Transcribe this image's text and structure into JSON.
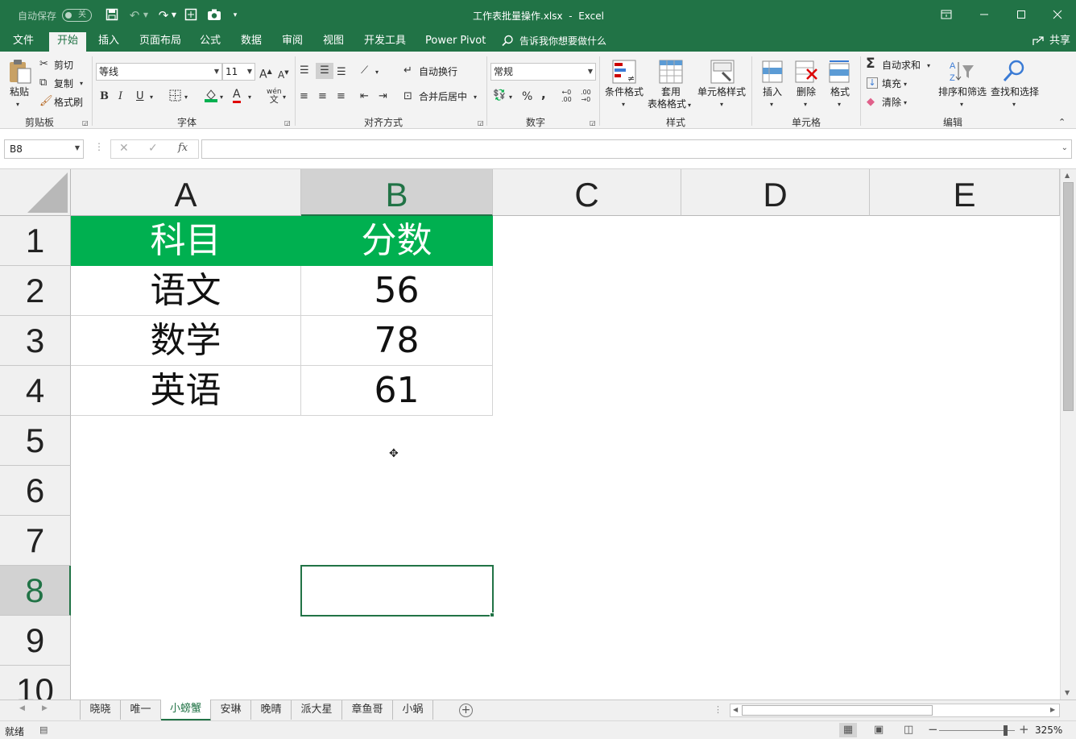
{
  "title_bar": {
    "autosave_label": "自动保存",
    "autosave_state": "关",
    "title": "工作表批量操作.xlsx  -  Excel"
  },
  "menu": {
    "tabs": [
      "文件",
      "开始",
      "插入",
      "页面布局",
      "公式",
      "数据",
      "审阅",
      "视图",
      "开发工具",
      "Power Pivot"
    ],
    "active": "开始",
    "tell_me": "告诉我你想要做什么",
    "share": "共享"
  },
  "ribbon": {
    "clipboard": {
      "label": "剪贴板",
      "paste": "粘贴",
      "cut": "剪切",
      "copy": "复制",
      "format_painter": "格式刷"
    },
    "font": {
      "label": "字体",
      "font_name": "等线",
      "font_size": "11",
      "bold": "B",
      "italic": "I",
      "underline": "U"
    },
    "alignment": {
      "label": "对齐方式",
      "wrap_text": "自动换行",
      "merge_center": "合并后居中"
    },
    "number": {
      "label": "数字",
      "format": "常规",
      "percent": "%",
      "comma": ","
    },
    "styles": {
      "label": "样式",
      "conditional": "条件格式",
      "table_format_1": "套用",
      "table_format_2": "表格格式",
      "cell_styles": "单元格样式"
    },
    "cells": {
      "label": "单元格",
      "insert": "插入",
      "delete": "删除",
      "format": "格式"
    },
    "editing": {
      "label": "编辑",
      "autosum": "自动求和",
      "fill": "填充",
      "clear": "清除",
      "sort_filter": "排序和筛选",
      "find_select": "查找和选择"
    }
  },
  "formula_bar": {
    "name_box": "B8",
    "fx": "fx",
    "value": ""
  },
  "grid": {
    "columns": [
      "A",
      "B",
      "C",
      "D",
      "E"
    ],
    "selected_column": "B",
    "rows": [
      "1",
      "2",
      "3",
      "4",
      "5",
      "6",
      "7",
      "8",
      "9",
      "10"
    ],
    "selected_row": "8",
    "cells": [
      [
        "科目",
        "分数"
      ],
      [
        "语文",
        "56"
      ],
      [
        "数学",
        "78"
      ],
      [
        "英语",
        "61"
      ]
    ]
  },
  "sheets": {
    "tabs": [
      "晓晓",
      "唯一",
      "小螃蟹",
      "安琳",
      "晚晴",
      "派大星",
      "章鱼哥",
      "小蜗"
    ],
    "active": "小螃蟹"
  },
  "status_bar": {
    "status": "就绪",
    "zoom": "325%"
  },
  "colors": {
    "accent": "#217346",
    "header_fill": "#00b050"
  }
}
